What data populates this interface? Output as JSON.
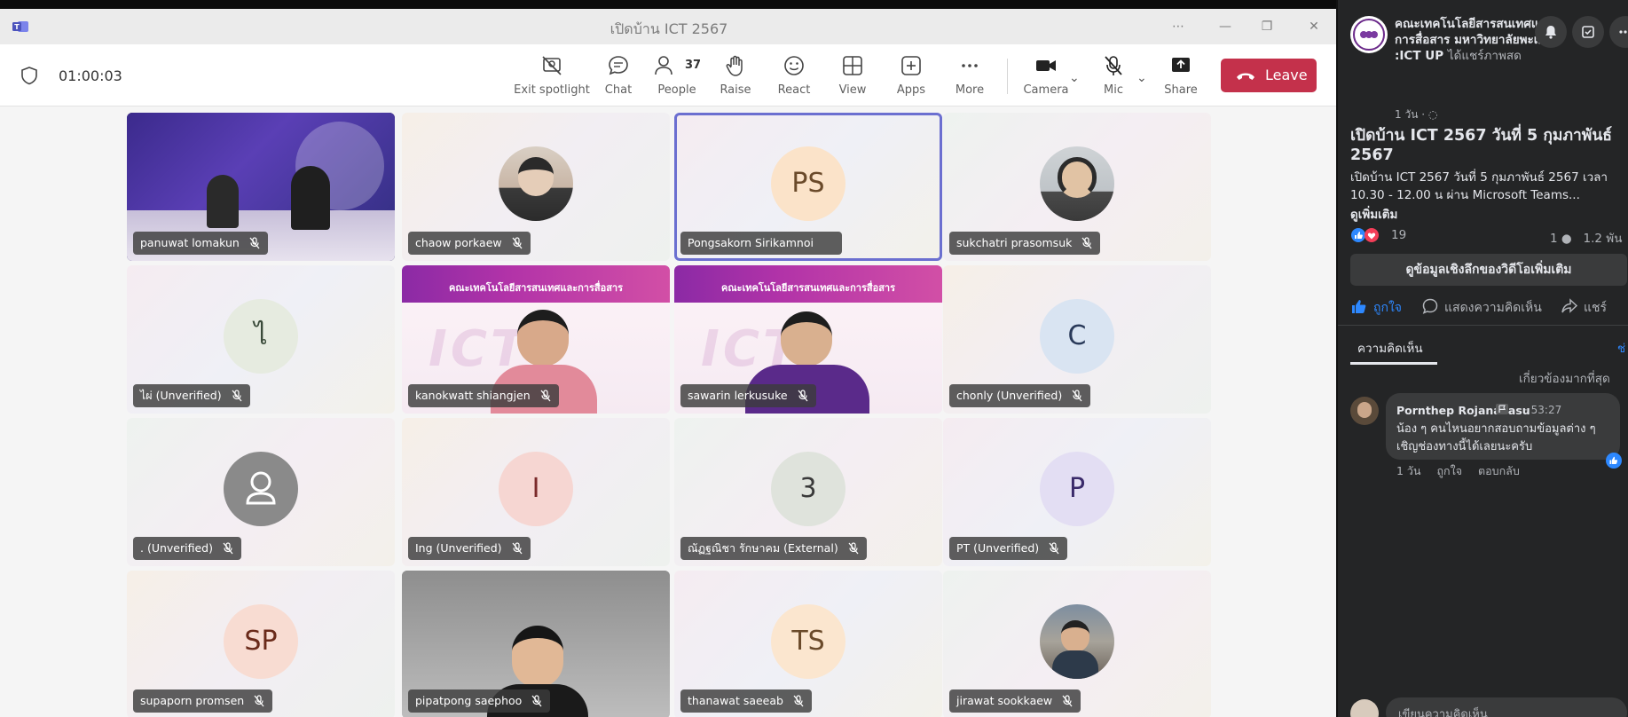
{
  "window": {
    "title": "เปิดบ้าน ICT 2567"
  },
  "toolbar": {
    "timer": "01:00:03",
    "buttons": {
      "exit_spotlight": "Exit spotlight",
      "chat": "Chat",
      "people": "People",
      "people_count": "37",
      "raise": "Raise",
      "react": "React",
      "view": "View",
      "apps": "Apps",
      "more": "More",
      "camera": "Camera",
      "mic": "Mic",
      "share": "Share",
      "leave": "Leave"
    },
    "leave_color": "#c4314b"
  },
  "participants": [
    {
      "name": "panuwat lomakun",
      "kind": "video"
    },
    {
      "name": "chaow porkaew",
      "kind": "photo"
    },
    {
      "name": "Pongsakorn Sirikamnoi",
      "kind": "initials",
      "initials": "PS"
    },
    {
      "name": "sukchatri prasomsuk",
      "kind": "photo"
    },
    {
      "name": "ไผ่ (Unverified)",
      "kind": "initials",
      "initials": "ไ"
    },
    {
      "name": "kanokwatt shiangjen",
      "kind": "video",
      "banner": "คณะเทคโนโลยีสารสนเทศและการสื่อสาร"
    },
    {
      "name": "sawarin lerkusuke",
      "kind": "video",
      "banner": "คณะเทคโนโลยีสารสนเทศและการสื่อสาร"
    },
    {
      "name": "chonly (Unverified)",
      "kind": "initials",
      "initials": "C"
    },
    {
      "name": ". (Unverified)",
      "kind": "person-icon"
    },
    {
      "name": "Ing (Unverified)",
      "kind": "initials",
      "initials": "I"
    },
    {
      "name": "ณัฏฐณิชา รักษาคม (External)",
      "kind": "initials",
      "initials": "3"
    },
    {
      "name": "PT (Unverified)",
      "kind": "initials",
      "initials": "P"
    },
    {
      "name": "supaporn promsen",
      "kind": "initials",
      "initials": "SP"
    },
    {
      "name": "pipatpong saephoo",
      "kind": "video"
    },
    {
      "name": "thanawat saeeab",
      "kind": "initials",
      "initials": "TS"
    },
    {
      "name": "jirawat sookkaew",
      "kind": "photo"
    }
  ],
  "facebook": {
    "page_name": "คณะเทคโนโลยีสารสนเทศและการสื่อสาร มหาวิทยาลัยพะเยา :ICT UP",
    "shared_live": "ได้แชร์ภาพสด",
    "posted_ago": "1 วัน ·",
    "headline": "เปิดบ้าน ICT 2567 วันที่ 5 กุมภาพันธ์",
    "headline2": "2567",
    "description": "เปิดบ้าน ICT 2567 วันที่ 5 กุมภาพันธ์ 2567 เวลา 10.30 - 12.00 น ผ่าน Microsoft Teams...",
    "see_more": "ดูเพิ่มเติม",
    "reaction_count": "19",
    "comment_count": "1",
    "view_count": "1.2 พัน",
    "insights_button": "ดูข้อมูลเชิงลึกของวิดีโอเพิ่มเติม",
    "actions": {
      "like": "ถูกใจ",
      "comment": "แสดงความคิดเห็น",
      "share": "แชร์"
    },
    "comments_tab": "ความคิดเห็น",
    "tab_right": "ช่",
    "sort_label": "เกี่ยวข้องมากที่สุด",
    "comment": {
      "author": "Pornthep Rojanavasu",
      "time": "53:27",
      "text": "น้อง ๆ คนไหนอยากสอบถามข้อมูลต่าง ๆ เชิญช่องทางนี้ได้เลยนะครับ",
      "ago": "1 วัน",
      "like": "ถูกใจ",
      "reply": "ตอบกลับ"
    },
    "compose_placeholder": "เขียนความคิดเห็น"
  }
}
